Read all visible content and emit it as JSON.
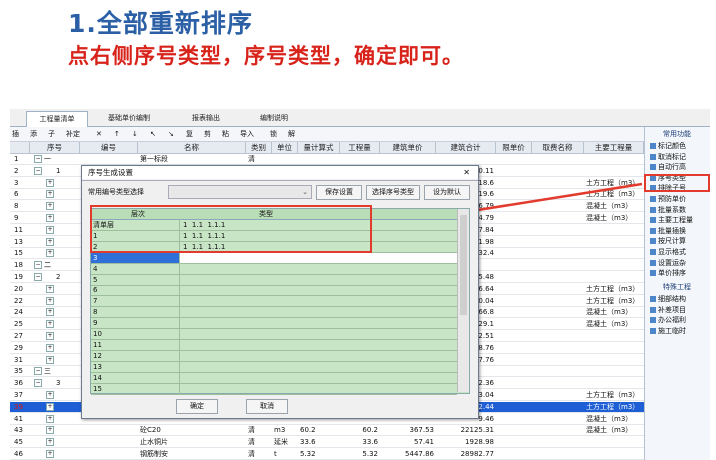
{
  "heading": {
    "title": "1.全部重新排序",
    "subtitle": "点右侧序号类型，序号类型，确定即可。"
  },
  "tabs": [
    "工程量清单",
    "基础单价编制",
    "报表输出",
    "编制说明"
  ],
  "toolbar": [
    "插",
    "添",
    "子",
    "补定",
    "✕",
    "↑",
    "↓",
    "↖",
    "↘",
    "复",
    "剪",
    "粘",
    "导入",
    "锁",
    "解"
  ],
  "columns": [
    "序号",
    "编号",
    "名称",
    "类别",
    "单位",
    "量计算式",
    "工程量",
    "建筑单价",
    "建筑合计",
    "限单价",
    "取费名称",
    "主要工程量"
  ],
  "rows": [
    {
      "n": "1",
      "seq": "一",
      "name": "第一标段",
      "cat": "清",
      "unit": "",
      "calc": "",
      "qty": "",
      "price": "",
      "total": "",
      "main": ""
    },
    {
      "n": "2",
      "seq": "1",
      "name": "",
      "cat": "",
      "unit": "",
      "calc": "",
      "qty": "",
      "price": "",
      "total": "0.11",
      "main": ""
    },
    {
      "n": "3",
      "seq": "",
      "name": "",
      "cat": "",
      "unit": "",
      "calc": "",
      "qty": "",
      "price": "",
      "total": "18.6",
      "main": "土方工程（m3）"
    },
    {
      "n": "6",
      "seq": "",
      "name": "",
      "cat": "",
      "unit": "",
      "calc": "",
      "qty": "",
      "price": "",
      "total": "19.6",
      "main": "土方工程（m3）"
    },
    {
      "n": "8",
      "seq": "",
      "name": "",
      "cat": "",
      "unit": "",
      "calc": "",
      "qty": "",
      "price": "",
      "total": "6.79",
      "main": "混凝土（m3）"
    },
    {
      "n": "9",
      "seq": "",
      "name": "",
      "cat": "",
      "unit": "",
      "calc": "",
      "qty": "",
      "price": "",
      "total": "4.79",
      "main": "混凝土（m3）"
    },
    {
      "n": "11",
      "seq": "",
      "name": "",
      "cat": "",
      "unit": "",
      "calc": "",
      "qty": "",
      "price": "",
      "total": "7.84",
      "main": ""
    },
    {
      "n": "13",
      "seq": "",
      "name": "",
      "cat": "",
      "unit": "",
      "calc": "",
      "qty": "",
      "price": "",
      "total": "1.98",
      "main": ""
    },
    {
      "n": "15",
      "seq": "",
      "name": "",
      "cat": "",
      "unit": "",
      "calc": "",
      "qty": "",
      "price": "",
      "total": "32.4",
      "main": ""
    },
    {
      "n": "18",
      "seq": "二",
      "name": "",
      "cat": "",
      "unit": "",
      "calc": "",
      "qty": "",
      "price": "",
      "total": "",
      "main": ""
    },
    {
      "n": "19",
      "seq": "2",
      "name": "",
      "cat": "",
      "unit": "",
      "calc": "",
      "qty": "",
      "price": "",
      "total": "5.48",
      "main": ""
    },
    {
      "n": "20",
      "seq": "",
      "name": "",
      "cat": "",
      "unit": "",
      "calc": "",
      "qty": "",
      "price": "",
      "total": "6.64",
      "main": "土方工程（m3）"
    },
    {
      "n": "22",
      "seq": "",
      "name": "",
      "cat": "",
      "unit": "",
      "calc": "",
      "qty": "",
      "price": "",
      "total": "0.04",
      "main": "土方工程（m3）"
    },
    {
      "n": "24",
      "seq": "",
      "name": "",
      "cat": "",
      "unit": "",
      "calc": "",
      "qty": "",
      "price": "",
      "total": "66.8",
      "main": "混凝土（m3）"
    },
    {
      "n": "25",
      "seq": "",
      "name": "",
      "cat": "",
      "unit": "",
      "calc": "",
      "qty": "",
      "price": "",
      "total": "29.1",
      "main": "混凝土（m3）"
    },
    {
      "n": "27",
      "seq": "",
      "name": "",
      "cat": "",
      "unit": "",
      "calc": "",
      "qty": "",
      "price": "",
      "total": "2.51",
      "main": ""
    },
    {
      "n": "29",
      "seq": "",
      "name": "",
      "cat": "",
      "unit": "",
      "calc": "",
      "qty": "",
      "price": "",
      "total": "8.76",
      "main": ""
    },
    {
      "n": "31",
      "seq": "",
      "name": "",
      "cat": "",
      "unit": "",
      "calc": "",
      "qty": "",
      "price": "",
      "total": "7.76",
      "main": ""
    },
    {
      "n": "35",
      "seq": "三",
      "name": "",
      "cat": "",
      "unit": "",
      "calc": "",
      "qty": "",
      "price": "",
      "total": "",
      "main": ""
    },
    {
      "n": "36",
      "seq": "3",
      "name": "",
      "cat": "",
      "unit": "",
      "calc": "",
      "qty": "",
      "price": "",
      "total": "2.36",
      "main": ""
    },
    {
      "n": "37",
      "seq": "",
      "name": "",
      "cat": "",
      "unit": "",
      "calc": "",
      "qty": "",
      "price": "",
      "total": "3.04",
      "main": "土方工程（m3）"
    },
    {
      "n": "39",
      "seq": "",
      "name": "",
      "cat": "",
      "unit": "",
      "calc": "",
      "qty": "",
      "price": "",
      "total": "2.44",
      "main": "土方工程（m3）",
      "sel": true
    },
    {
      "n": "41",
      "seq": "",
      "name": "",
      "cat": "",
      "unit": "",
      "calc": "",
      "qty": "",
      "price": "",
      "total": "9.46",
      "main": "混凝土（m3）"
    },
    {
      "n": "43",
      "seq": "",
      "name": "砼C20",
      "cat": "清",
      "unit": "m3",
      "calc": "60.2",
      "qty": "60.2",
      "price": "367.53",
      "total": "22125.31",
      "main": "混凝土（m3）"
    },
    {
      "n": "45",
      "seq": "",
      "name": "止水铜片",
      "cat": "清",
      "unit": "延米",
      "calc": "33.6",
      "qty": "33.6",
      "price": "57.41",
      "total": "1928.98",
      "main": ""
    },
    {
      "n": "46",
      "seq": "",
      "name": "钢筋制安",
      "cat": "清",
      "unit": "t",
      "calc": "5.32",
      "qty": "5.32",
      "price": "5447.86",
      "total": "28982.77",
      "main": ""
    }
  ],
  "panel": {
    "section1": "常用功能",
    "items1": [
      "标记颜色",
      "取消标记",
      "自动行高",
      "序号类型",
      "排除子号",
      "预防单价",
      "批量系数",
      "主要工程量",
      "批量插换",
      "按尺计算",
      "显示格式",
      "设置运杂",
      "单价排序"
    ],
    "section2": "特殊工程",
    "items2": [
      "细部结构",
      "补差项目",
      "办公福利",
      "施工临时"
    ]
  },
  "dialog": {
    "title": "序号生成设置",
    "close": "✕",
    "select_label": "常用编号类型选择",
    "save_btn": "保存设置",
    "choose_btn": "选择序号类型",
    "default_btn": "设为默认",
    "col_level": "层次",
    "col_type": "类型",
    "rows": [
      {
        "level": "清单层",
        "type": "1  1.1  1.1.1"
      },
      {
        "level": "1",
        "type": "1  1.1  1.1.1"
      },
      {
        "level": "2",
        "type": "1  1.1  1.1.1"
      },
      {
        "level": "3",
        "type": ""
      },
      {
        "level": "4",
        "type": ""
      },
      {
        "level": "5",
        "type": ""
      },
      {
        "level": "6",
        "type": ""
      },
      {
        "level": "7",
        "type": ""
      },
      {
        "level": "8",
        "type": ""
      },
      {
        "level": "9",
        "type": ""
      },
      {
        "level": "10",
        "type": ""
      },
      {
        "level": "11",
        "type": ""
      },
      {
        "level": "12",
        "type": ""
      },
      {
        "level": "13",
        "type": ""
      },
      {
        "level": "14",
        "type": ""
      },
      {
        "level": "15",
        "type": ""
      }
    ],
    "ok": "确定",
    "cancel": "取消"
  }
}
